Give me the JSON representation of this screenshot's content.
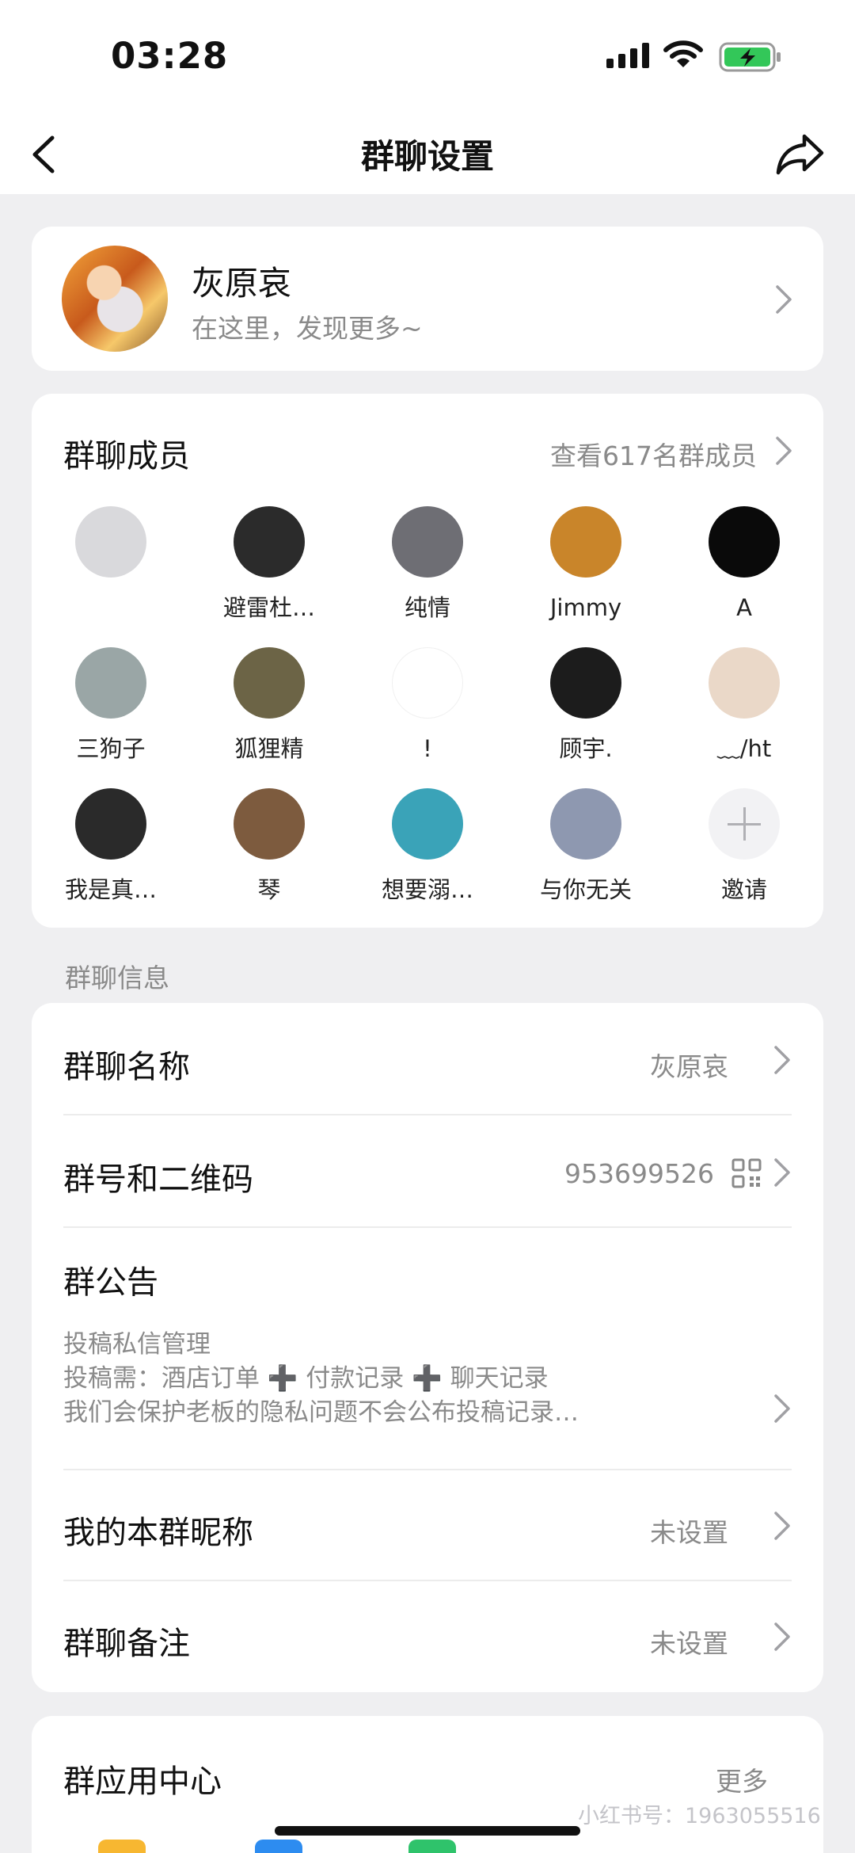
{
  "status_bar": {
    "time": "03:28"
  },
  "nav": {
    "title": "群聊设置"
  },
  "profile": {
    "name": "灰原哀",
    "subtitle": "在这里，发现更多~"
  },
  "members": {
    "title": "群聊成员",
    "view_all": "查看617名群成员",
    "list": [
      {
        "name": "",
        "color": "#d9d9dc"
      },
      {
        "name": "避雷杜…",
        "color": "#2b2b2b"
      },
      {
        "name": "纯情",
        "color": "#6e6e74"
      },
      {
        "name": "Jimmy",
        "color": "#c9852a"
      },
      {
        "name": "A",
        "color": "#0a0a0a"
      },
      {
        "name": "三狗子",
        "color": "#9aa6a6"
      },
      {
        "name": "狐狸精",
        "color": "#6c6446"
      },
      {
        "name": "!",
        "color": "#ffffff"
      },
      {
        "name": "顾宇.",
        "color": "#1c1c1c"
      },
      {
        "name": "﹏/ht",
        "color": "#ead8c8"
      },
      {
        "name": "我是真…",
        "color": "#2a2a2a"
      },
      {
        "name": "琴",
        "color": "#7d5b3e"
      },
      {
        "name": "想要溺…",
        "color": "#3aa3b8"
      },
      {
        "name": "与你无关",
        "color": "#8e98b0"
      },
      {
        "name": "邀请",
        "color": "invite"
      }
    ]
  },
  "info_section_label": "群聊信息",
  "info": {
    "group_name_label": "群聊名称",
    "group_name_value": "灰原哀",
    "group_id_label": "群号和二维码",
    "group_id_value": "953699526",
    "notice_label": "群公告",
    "notice_lines": [
      "投稿私信管理",
      "投稿需：酒店订单 ➕ 付款记录 ➕ 聊天记录",
      "我们会保护老板的隐私问题不会公布投稿记录…"
    ],
    "nickname_label": "我的本群昵称",
    "nickname_value": "未设置",
    "remark_label": "群聊备注",
    "remark_value": "未设置"
  },
  "apps": {
    "title": "群应用中心",
    "more": "更多"
  },
  "watermark": "小红书号：1963055516"
}
